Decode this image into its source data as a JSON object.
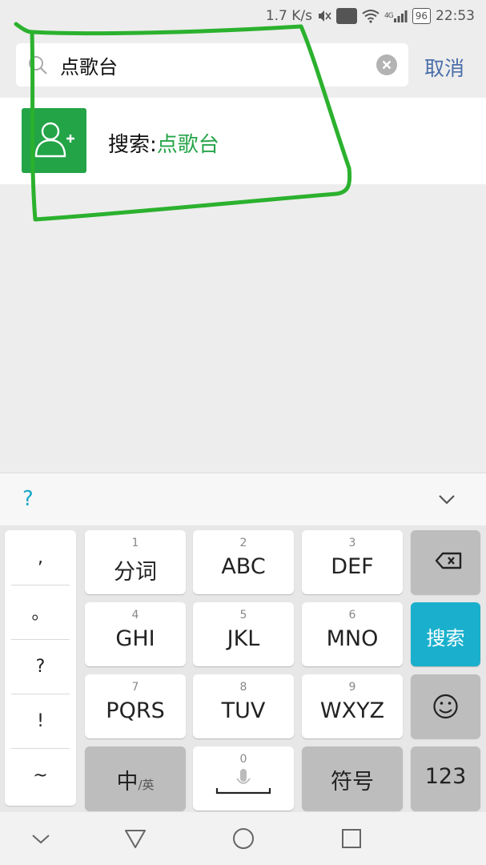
{
  "status_bar": {
    "net_speed": "1.7 K/s",
    "hd_badge": "HD",
    "signal_label": "4G",
    "battery": "96",
    "time": "22:53"
  },
  "search": {
    "query": "点歌台",
    "cancel_label": "取消"
  },
  "result": {
    "prefix": "搜索:",
    "keyword": "点歌台"
  },
  "keyboard": {
    "toolbar_symbol": "?",
    "punctuation": [
      ",",
      "。",
      "?",
      "!",
      "~"
    ],
    "keys": [
      {
        "num": "1",
        "label": "分词"
      },
      {
        "num": "2",
        "label": "ABC"
      },
      {
        "num": "3",
        "label": "DEF"
      },
      {
        "num": "4",
        "label": "GHI"
      },
      {
        "num": "5",
        "label": "JKL"
      },
      {
        "num": "6",
        "label": "MNO"
      },
      {
        "num": "7",
        "label": "PQRS"
      },
      {
        "num": "8",
        "label": "TUV"
      },
      {
        "num": "9",
        "label": "WXYZ"
      }
    ],
    "search_key": "搜索",
    "lang_main": "中",
    "lang_sub": "/英",
    "space_num": "0",
    "symbols_key": "符号",
    "numbers_key": "123"
  },
  "colors": {
    "accent_green": "#23a447",
    "keyword_green": "#26a44a",
    "cancel_blue": "#4a6ea9",
    "search_key_cyan": "#1ab0cd",
    "annotation_green": "#2bb12e"
  }
}
